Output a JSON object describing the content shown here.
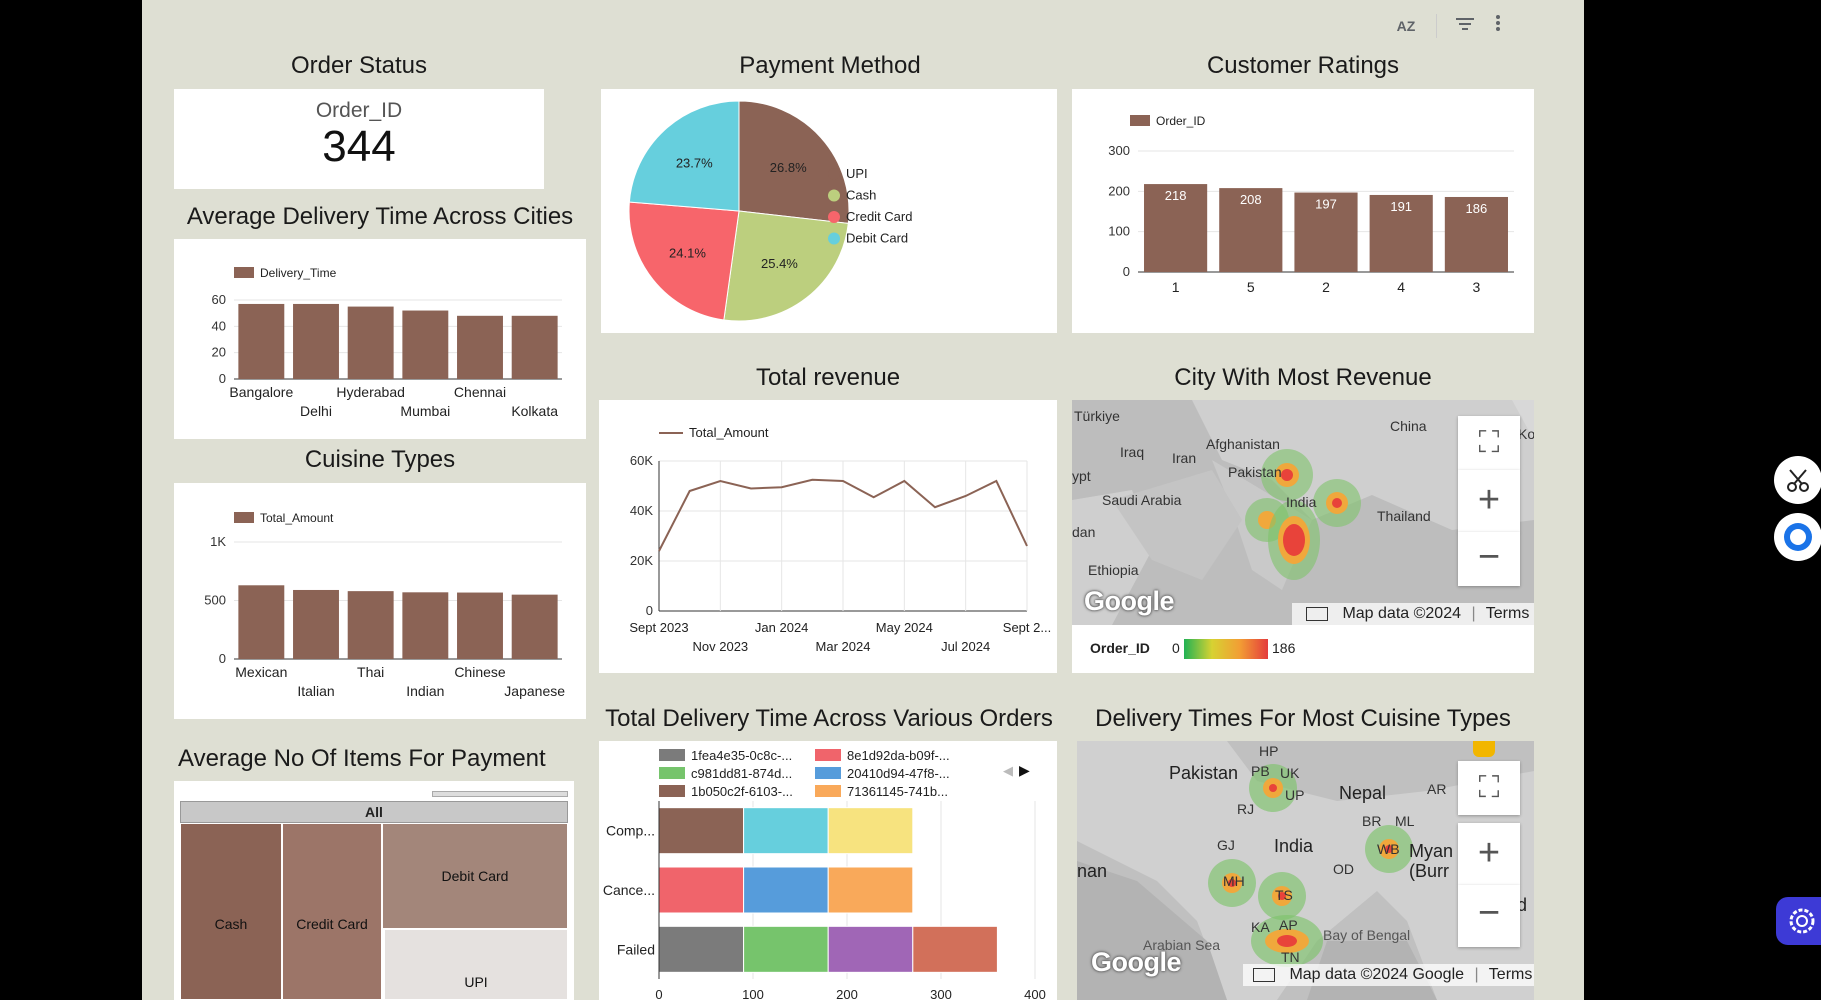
{
  "toolbar": {
    "sort_icon": "AZ",
    "filter_icon": "filter-icon",
    "more_icon": "more-vert-icon"
  },
  "order_status": {
    "title": "Order Status",
    "metric_label": "Order_ID",
    "metric_value": "344"
  },
  "payment_method": {
    "title": "Payment Method",
    "chart_data": {
      "type": "pie",
      "labels": [
        "UPI",
        "Cash",
        "Credit Card",
        "Debit Card"
      ],
      "values": [
        26.8,
        25.4,
        24.1,
        23.7
      ],
      "value_labels": [
        "26.8%",
        "25.4%",
        "24.1%",
        "23.7%"
      ],
      "colors": [
        "#8b6355",
        "#bccf7e",
        "#f7656b",
        "#66cfdd"
      ],
      "legend": "right"
    }
  },
  "customer_ratings": {
    "title": "Customer Ratings",
    "chart_data": {
      "type": "bar",
      "legend": "Order_ID",
      "categories": [
        "1",
        "5",
        "2",
        "4",
        "3"
      ],
      "values": [
        218,
        208,
        197,
        191,
        186
      ],
      "value_labels": [
        "218",
        "208",
        "197",
        "191",
        "186"
      ],
      "yticks": [
        "300",
        "200",
        "100",
        "0"
      ],
      "ylim": [
        0,
        300
      ],
      "color": "#8b6355"
    }
  },
  "avg_delivery": {
    "title": "Average Delivery Time Across Cities",
    "chart_data": {
      "type": "bar",
      "legend": "Delivery_Time",
      "categories": [
        "Bangalore",
        "Delhi",
        "Hyderabad",
        "Mumbai",
        "Chennai",
        "Kolkata"
      ],
      "values": [
        57,
        57,
        55,
        52,
        48,
        48
      ],
      "yticks": [
        "60",
        "40",
        "20",
        "0"
      ],
      "ylim": [
        0,
        60
      ],
      "color": "#8b6355"
    }
  },
  "cuisine_types": {
    "title": "Cuisine Types",
    "chart_data": {
      "type": "bar",
      "legend": "Total_Amount",
      "categories": [
        "Mexican",
        "Italian",
        "Thai",
        "Indian",
        "Chinese",
        "Japanese"
      ],
      "values": [
        630,
        590,
        580,
        570,
        568,
        550
      ],
      "yticks": [
        "1K",
        "500",
        "0"
      ],
      "ylim": [
        0,
        1000
      ],
      "color": "#8b6355"
    }
  },
  "total_revenue": {
    "title": "Total revenue",
    "chart_data": {
      "type": "line",
      "legend": "Total_Amount",
      "x": [
        "Sept 2023",
        "Oct 2023",
        "Nov 2023",
        "Dec 2023",
        "Jan 2024",
        "Feb 2024",
        "Mar 2024",
        "Apr 2024",
        "May 2024",
        "Jun 2024",
        "Jul 2024",
        "Aug 2024",
        "Sept 2024"
      ],
      "values": [
        24000,
        48000,
        52000,
        49000,
        49500,
        52500,
        52000,
        45500,
        52000,
        41500,
        46000,
        52000,
        26000
      ],
      "xticks_top": [
        "Sept 2023",
        "Jan 2024",
        "May 2024",
        "Sept 2..."
      ],
      "xticks_bottom": [
        "Nov 2023",
        "Mar 2024",
        "Jul 2024"
      ],
      "yticks": [
        "60K",
        "40K",
        "20K",
        "0"
      ],
      "ylim": [
        0,
        60000
      ],
      "color": "#8b6355"
    }
  },
  "city_revenue": {
    "title": "City With Most Revenue",
    "labels": [
      "Türkiye",
      "Iraq",
      "Iran",
      "Afghanistan",
      "Pakistan",
      "Saudi Arabia",
      "India",
      "Thailand",
      "China",
      "Ethiopia",
      "ypt",
      "dan",
      "Ko"
    ],
    "map_data": "Map data ©2024",
    "terms": "Terms",
    "legend_label": "Order_ID",
    "legend_min": "0",
    "legend_max": "186"
  },
  "total_delivery": {
    "title": "Total Delivery Time Across Various Orders",
    "legend": [
      {
        "name": "1fea4e35-0c8c-...",
        "color": "#7b7b7b"
      },
      {
        "name": "8e1d92da-b09f-...",
        "color": "#f0646b"
      },
      {
        "name": "c981dd81-874d...",
        "color": "#76c46c"
      },
      {
        "name": "20410d94-47f8-...",
        "color": "#569cdb"
      },
      {
        "name": "1b050c2f-6103-...",
        "color": "#8b6355"
      },
      {
        "name": "71361145-741b...",
        "color": "#f9a95a"
      }
    ],
    "chart_data": {
      "type": "bar",
      "orientation": "horizontal",
      "stacked": true,
      "categories": [
        "Comp...",
        "Cance...",
        "Failed"
      ],
      "series": [
        {
          "colors": [
            "#8b6355",
            "#f0646b",
            "#7b7b7b"
          ],
          "values": [
            90,
            90,
            90
          ]
        },
        {
          "colors": [
            "#66cfdd",
            "#569cdb",
            "#76c46c"
          ],
          "values": [
            90,
            90,
            90
          ]
        },
        {
          "colors": [
            "#f7e37f",
            "#f9a95a",
            "#a066b6"
          ],
          "values": [
            90,
            90,
            90
          ]
        },
        {
          "colors": [
            "",
            "",
            "#d2705a"
          ],
          "values": [
            0,
            0,
            90
          ]
        }
      ],
      "xticks": [
        "0",
        "100",
        "200",
        "300",
        "400"
      ],
      "xlim": [
        0,
        400
      ]
    }
  },
  "cuisine_delivery": {
    "title": "Delivery Times For Most Cuisine Types",
    "labels": [
      "HP",
      "Pakistan",
      "PB",
      "UK",
      "UP",
      "Nepal",
      "AR",
      "RJ",
      "BR",
      "ML",
      "India",
      "WB",
      "Myan",
      "(Burr",
      "GJ",
      "OD",
      "nan",
      "MH",
      "TS",
      "KA",
      "AP",
      "Arabian Sea",
      "Bay of Bengal",
      "TN",
      "d"
    ],
    "map_data": "Map data ©2024 Google",
    "terms": "Terms"
  },
  "avg_items": {
    "title": "Average No Of Items For Payment",
    "root": "All",
    "tiles": [
      "Cash",
      "Credit Card",
      "Debit Card",
      "UPI"
    ]
  }
}
